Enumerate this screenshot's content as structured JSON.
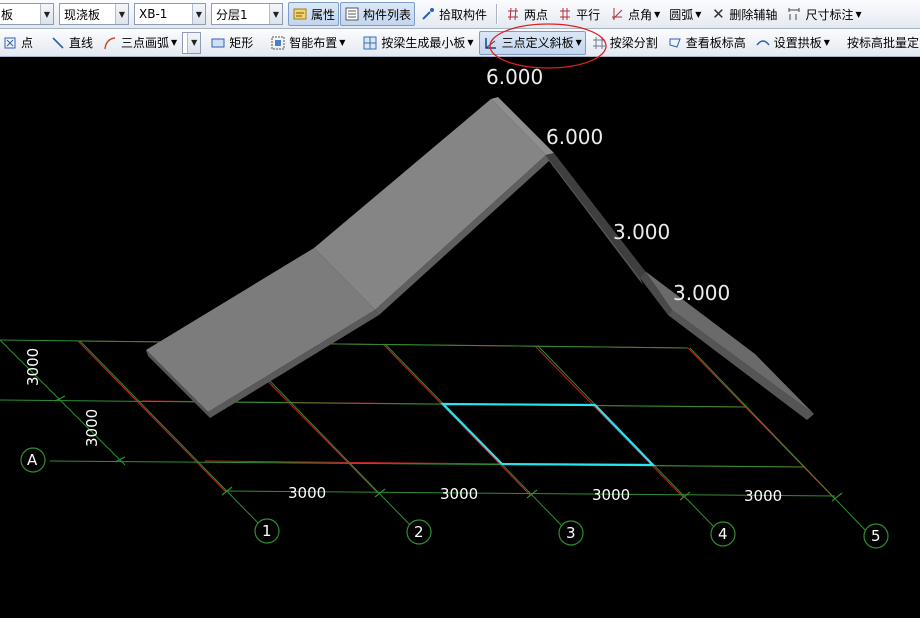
{
  "toolbar1": {
    "type_combo_value": "板",
    "slab_type_combo_value": "现浇板",
    "component_combo_value": "XB-1",
    "layer_combo_value": "分层1",
    "properties_label": "属性",
    "component_list_label": "构件列表",
    "pick_component_label": "拾取构件",
    "two_points_label": "两点",
    "parallel_label": "平行",
    "point_angle_label": "点角",
    "arc_label": "圆弧",
    "delete_aux_label": "删除辅轴",
    "dimension_label": "尺寸标注"
  },
  "toolbar2": {
    "point_label": "点",
    "line_label": "直线",
    "three_point_arc_label": "三点画弧",
    "arc_combo_value": "",
    "rectangle_label": "矩形",
    "smart_layout_label": "智能布置",
    "by_beam_min_slab_label": "按梁生成最小板",
    "three_point_slope_label": "三点定义斜板",
    "by_beam_split_label": "按梁分割",
    "view_slab_elevation_label": "查看板标高",
    "set_arch_slab_label": "设置拱板",
    "batch_by_elevation_label": "按标高批量定"
  },
  "viewport": {
    "elevations": [
      "6.000",
      "6.000",
      "3.000",
      "3.000"
    ],
    "dimensions_x": [
      "3000",
      "3000",
      "3000",
      "3000"
    ],
    "dimensions_y": [
      "3000",
      "3000"
    ],
    "axis_numbers": [
      "1",
      "2",
      "3",
      "4",
      "5"
    ],
    "axis_letters": [
      "A"
    ]
  },
  "colors": {
    "grid_red": "#cc1f1f",
    "axis_green": "#2f8f2f",
    "selection_cyan": "#28e4f0",
    "slab_gray": "#8a8a8a",
    "highlight_circle": "#e02020",
    "background": "#000000"
  }
}
